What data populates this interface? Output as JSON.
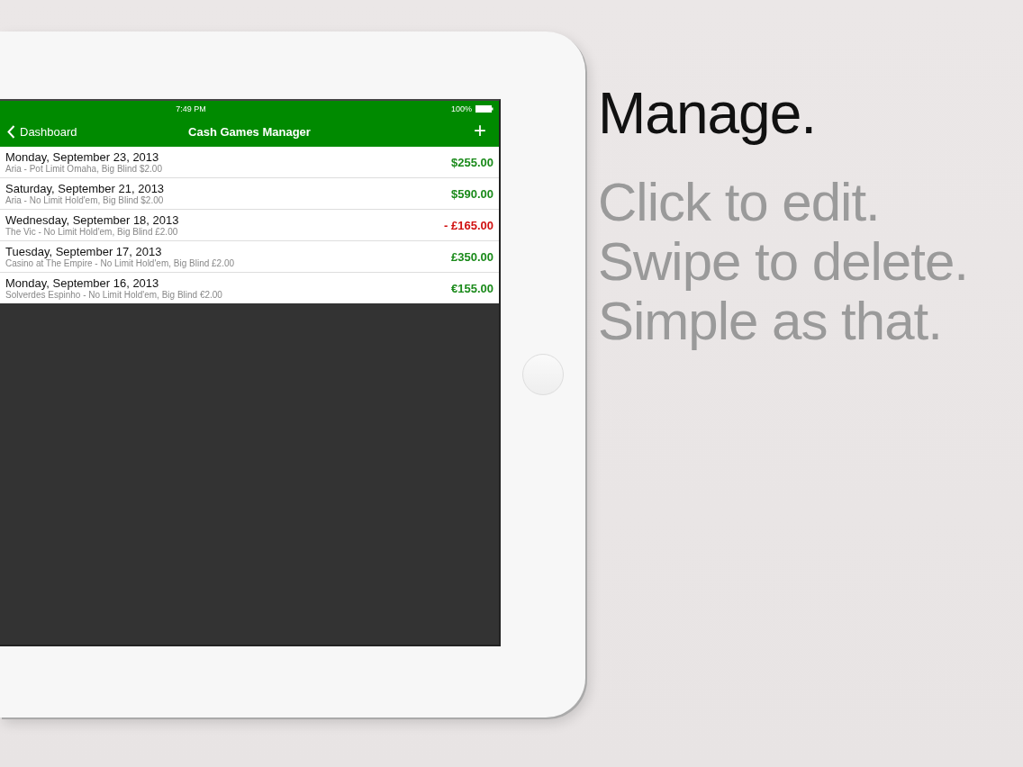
{
  "status_bar": {
    "time": "7:49 PM",
    "battery": "100%"
  },
  "nav_bar": {
    "back": "Dashboard",
    "title": "Cash Games Manager",
    "add": "+"
  },
  "sessions": [
    {
      "date": "Monday, September 23, 2013",
      "details": "Aria - Pot Limit Omaha, Big Blind $2.00",
      "amount": "$255.00",
      "kind": "win"
    },
    {
      "date": "Saturday, September 21, 2013",
      "details": "Aria - No Limit Hold'em, Big Blind $2.00",
      "amount": "$590.00",
      "kind": "win"
    },
    {
      "date": "Wednesday, September 18, 2013",
      "details": "The Vic - No Limit Hold'em, Big Blind £2.00",
      "amount": "- £165.00",
      "kind": "loss"
    },
    {
      "date": "Tuesday, September 17, 2013",
      "details": "Casino at The Empire - No Limit Hold'em, Big Blind £2.00",
      "amount": "£350.00",
      "kind": "win"
    },
    {
      "date": "Monday, September 16, 2013",
      "details": "Solverdes Espinho - No Limit Hold'em, Big Blind €2.00",
      "amount": "€155.00",
      "kind": "win"
    }
  ],
  "promo": {
    "headline": "Manage.",
    "lines": [
      "Click to edit.",
      "Swipe to delete.",
      "Simple as that."
    ]
  }
}
